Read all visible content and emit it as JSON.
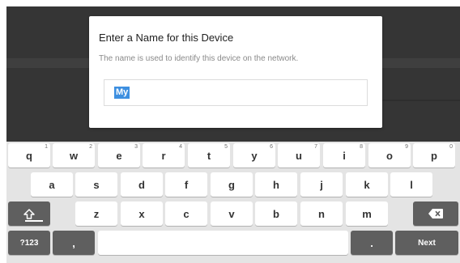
{
  "dialog": {
    "title": "Enter a Name for this Device",
    "subtitle": "The name is used to identify this device on the network.",
    "input_value": "My"
  },
  "keyboard": {
    "row1": [
      {
        "label": "q",
        "hint": "1"
      },
      {
        "label": "w",
        "hint": "2"
      },
      {
        "label": "e",
        "hint": "3"
      },
      {
        "label": "r",
        "hint": "4"
      },
      {
        "label": "t",
        "hint": "5"
      },
      {
        "label": "y",
        "hint": "6"
      },
      {
        "label": "u",
        "hint": "7"
      },
      {
        "label": "i",
        "hint": "8"
      },
      {
        "label": "o",
        "hint": "9"
      },
      {
        "label": "p",
        "hint": "0"
      }
    ],
    "row2": [
      "a",
      "s",
      "d",
      "f",
      "g",
      "h",
      "j",
      "k",
      "l"
    ],
    "row3": [
      "z",
      "x",
      "c",
      "v",
      "b",
      "n",
      "m"
    ],
    "shift_icon": "shift-arrow-icon",
    "backspace_icon": "backspace-icon",
    "symbols_label": "?123",
    "comma_label": ",",
    "period_label": ".",
    "next_label": "Next"
  },
  "colors": {
    "background": "#2a2a2a",
    "keyboard": "#e4e4e4",
    "selection": "#3d8fe0",
    "dark_key": "#5f5f5f"
  }
}
